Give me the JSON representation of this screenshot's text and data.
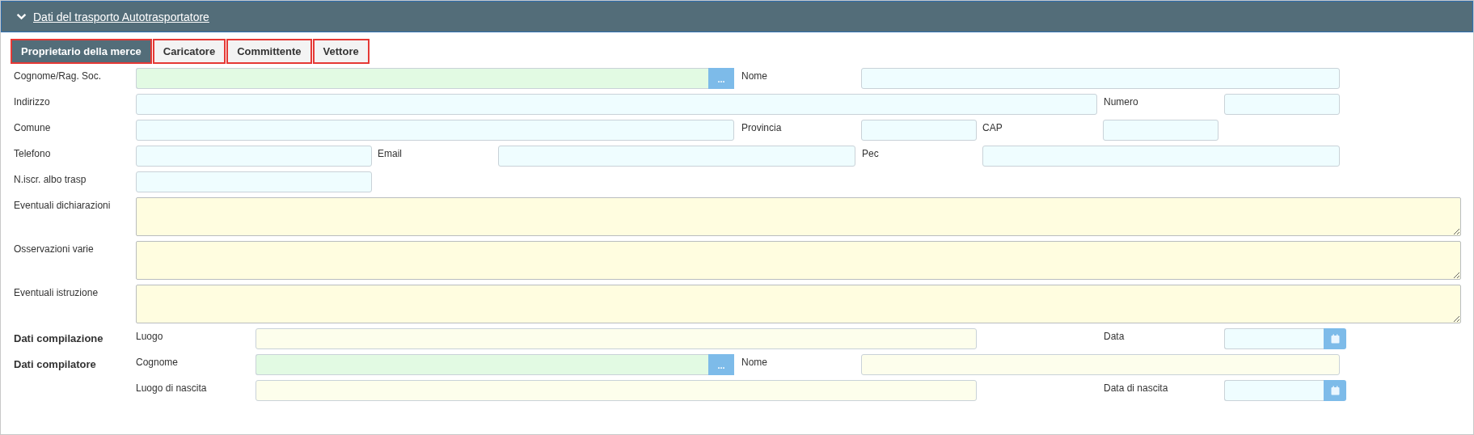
{
  "panel": {
    "title": "Dati del trasporto Autotrasportatore",
    "expanded": true
  },
  "tabs": [
    {
      "label": "Proprietario della merce",
      "selected": true
    },
    {
      "label": "Caricatore",
      "selected": false
    },
    {
      "label": "Committente",
      "selected": false
    },
    {
      "label": "Vettore",
      "selected": false
    }
  ],
  "fields": [
    {
      "label": "Cognome/Rag. Soc.",
      "kind": "lookup",
      "button": "..."
    },
    {
      "label": "Nome",
      "kind": "text"
    },
    {
      "label": "Indirizzo",
      "kind": "text"
    },
    {
      "label": "Numero",
      "kind": "text"
    },
    {
      "label": "Comune",
      "kind": "text"
    },
    {
      "label": "Provincia",
      "kind": "text"
    },
    {
      "label": "CAP",
      "kind": "text"
    },
    {
      "label": "Telefono",
      "kind": "text"
    },
    {
      "label": "Email",
      "kind": "text"
    },
    {
      "label": "Pec",
      "kind": "text"
    },
    {
      "label": "N.iscr. albo trasp",
      "kind": "text"
    },
    {
      "label": "Eventuali dichiarazioni",
      "kind": "textarea"
    },
    {
      "label": "Osservazioni varie",
      "kind": "textarea"
    },
    {
      "label": "Eventuali istruzione",
      "kind": "textarea"
    },
    {
      "label": "Luogo",
      "kind": "optional"
    },
    {
      "label": "Data",
      "kind": "date"
    },
    {
      "label": "Cognome",
      "kind": "lookup",
      "button": "..."
    },
    {
      "label": "Nome",
      "kind": "optional"
    },
    {
      "label": "Luogo di nascita",
      "kind": "optional"
    },
    {
      "label": "Data di nascita",
      "kind": "date"
    }
  ],
  "groups": [
    {
      "label": "Dati compilazione"
    },
    {
      "label": "Dati compilatore"
    }
  ]
}
